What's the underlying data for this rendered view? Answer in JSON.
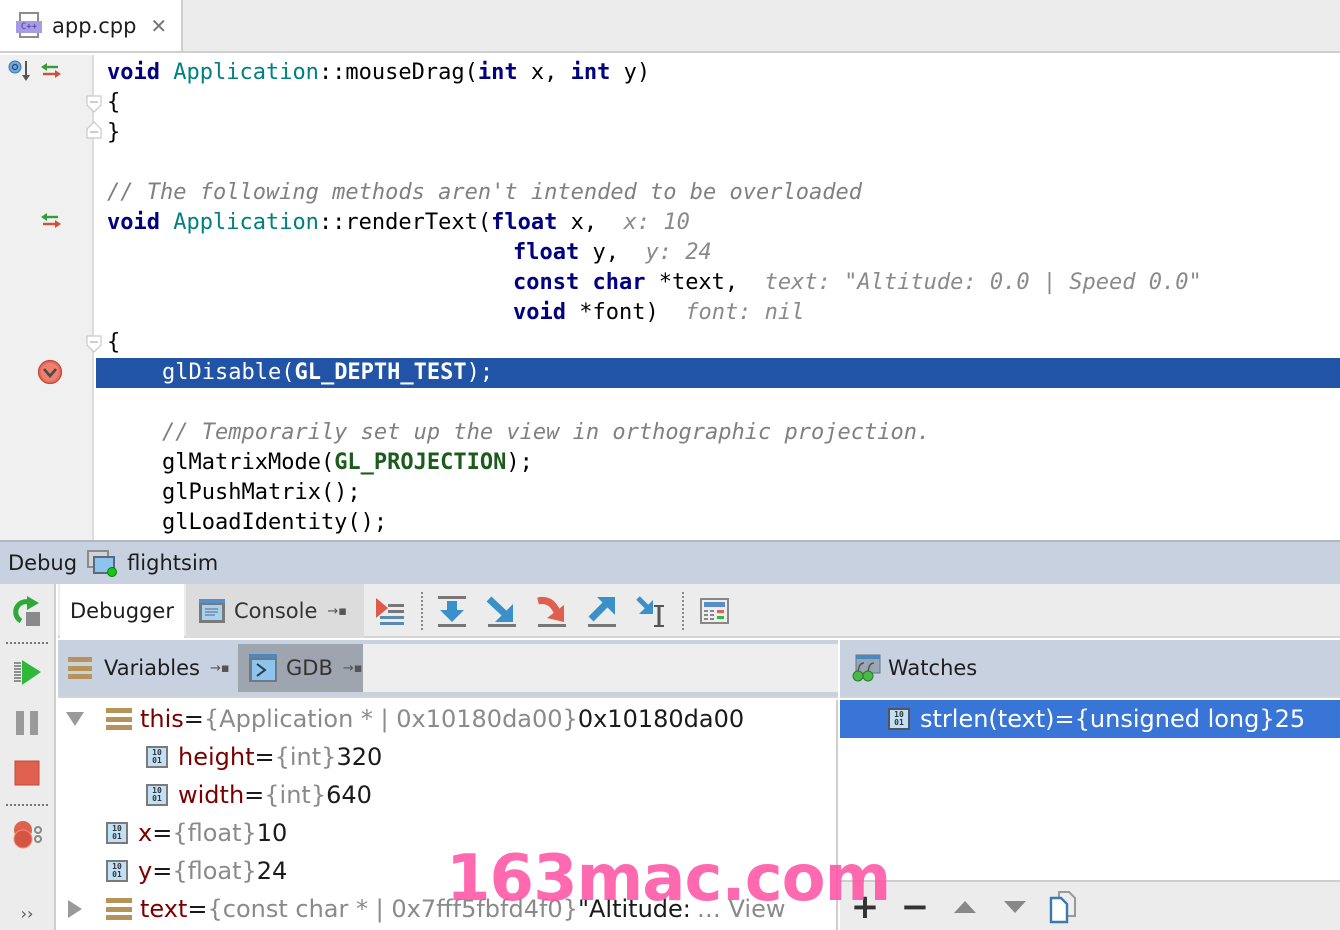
{
  "tabs": [
    {
      "label": "app.cpp",
      "icon": "cpp-file-icon",
      "badge": "C++",
      "close": "✕",
      "active": true
    }
  ],
  "editor": {
    "lines": {
      "l1": {
        "kw1": "void",
        "cls": "Application",
        "rest1": "::mouseDrag(",
        "kw2": "int",
        "rest2": " x, ",
        "kw3": "int",
        "rest3": " y)"
      },
      "l2": "{",
      "l3": "}",
      "l5": "// The following methods aren't intended to be overloaded",
      "l6": {
        "kw1": "void",
        "cls": "Application",
        "rest1": "::renderText(",
        "kw2": "float",
        "rest2": " x,",
        "hint": "x: 10"
      },
      "l7": {
        "kw": "float",
        "rest": " y,",
        "hint": "y: 24"
      },
      "l8": {
        "kw": "const char",
        "rest": " *text,",
        "hint": "text: \"Altitude: 0.0 | Speed 0.0\""
      },
      "l9": {
        "kw": "void",
        "rest": " *font)",
        "hint": "font: nil"
      },
      "l10": "{",
      "l11": {
        "fn": "glDisable(",
        "mac": "GL_DEPTH_TEST",
        "end": ");"
      },
      "l13": "// Temporarily set up the view in orthographic projection.",
      "l14": {
        "fn": "glMatrixMode(",
        "mac": "GL_PROJECTION",
        "end": ");"
      },
      "l15": "glPushMatrix();",
      "l16": "glLoadIdentity();"
    },
    "execution_line": 11,
    "highlight_color": "#2154a6"
  },
  "debug": {
    "title": "Debug",
    "run_config": "flightsim",
    "tabs": [
      {
        "label": "Debugger",
        "active": true
      },
      {
        "label": "Console",
        "active": false,
        "pin": "→▪"
      }
    ],
    "toolbar": [
      "show-execution-point-icon",
      "step-over-icon",
      "step-into-icon",
      "force-step-into-icon",
      "step-out-icon",
      "run-to-cursor-icon",
      "evaluate-expression-icon"
    ],
    "side_buttons": [
      "rerun-icon",
      "resume-icon",
      "pause-icon",
      "stop-icon",
      "view-breakpoints-icon",
      "more-icon"
    ],
    "more_label": "››",
    "variables": {
      "tabs": [
        {
          "label": "Variables",
          "pin": "→▪"
        },
        {
          "label": "GDB",
          "pin": "→▪"
        }
      ],
      "rows": [
        {
          "name": "this",
          "eq": " = ",
          "type": "{Application * | 0x10180da00}",
          "value": " 0x10180da00",
          "expanded": true
        },
        {
          "name": "height",
          "eq": " = ",
          "type": "{int}",
          "value": " 320"
        },
        {
          "name": "width",
          "eq": " = ",
          "type": "{int}",
          "value": " 640"
        },
        {
          "name": "x",
          "eq": " = ",
          "type": "{float}",
          "value": " 10"
        },
        {
          "name": "y",
          "eq": " = ",
          "type": "{float}",
          "value": " 24"
        },
        {
          "name": "text",
          "eq": " = ",
          "type": "{const char * | 0x7fff5fbfd4f0}",
          "value": " \"Altitude: ",
          "ellipsis": "… View",
          "expanded": false
        }
      ]
    },
    "watches": {
      "label": "Watches",
      "rows": [
        {
          "expr": "strlen(text)",
          "eq": " = ",
          "type": "{unsigned long}",
          "value": " 25",
          "selected": true
        }
      ],
      "toolbar": {
        "add": "+",
        "remove": "−"
      }
    }
  },
  "watermark": "163mac.com"
}
